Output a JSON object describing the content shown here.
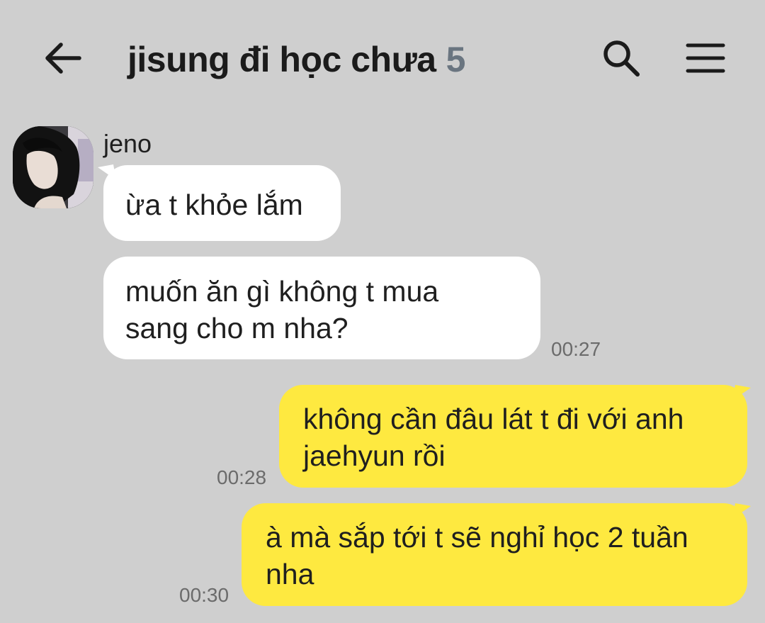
{
  "header": {
    "title": "jisung đi học chưa",
    "member_count": "5"
  },
  "icons": {
    "back": "arrow-left-icon",
    "search": "search-icon",
    "menu": "hamburger-menu-icon"
  },
  "colors": {
    "background": "#cfcfcf",
    "incoming_bubble": "#ffffff",
    "outgoing_bubble": "#fee940",
    "count_color": "#6a7580"
  },
  "messages": [
    {
      "direction": "incoming",
      "sender": "jeno",
      "text": "ừa t khỏe lắm"
    },
    {
      "direction": "incoming",
      "text_line1": "muốn ăn gì không t mua",
      "text_line2": "sang cho m nha?",
      "time": "00:27"
    },
    {
      "direction": "outgoing",
      "text_line1": "không cần đâu lát t đi với anh",
      "text_line2": "jaehyun rồi",
      "time": "00:28"
    },
    {
      "direction": "outgoing",
      "text_line1": "à mà sắp tới t sẽ nghỉ học 2 tuần",
      "text_line2": "nha",
      "time": "00:30"
    }
  ]
}
